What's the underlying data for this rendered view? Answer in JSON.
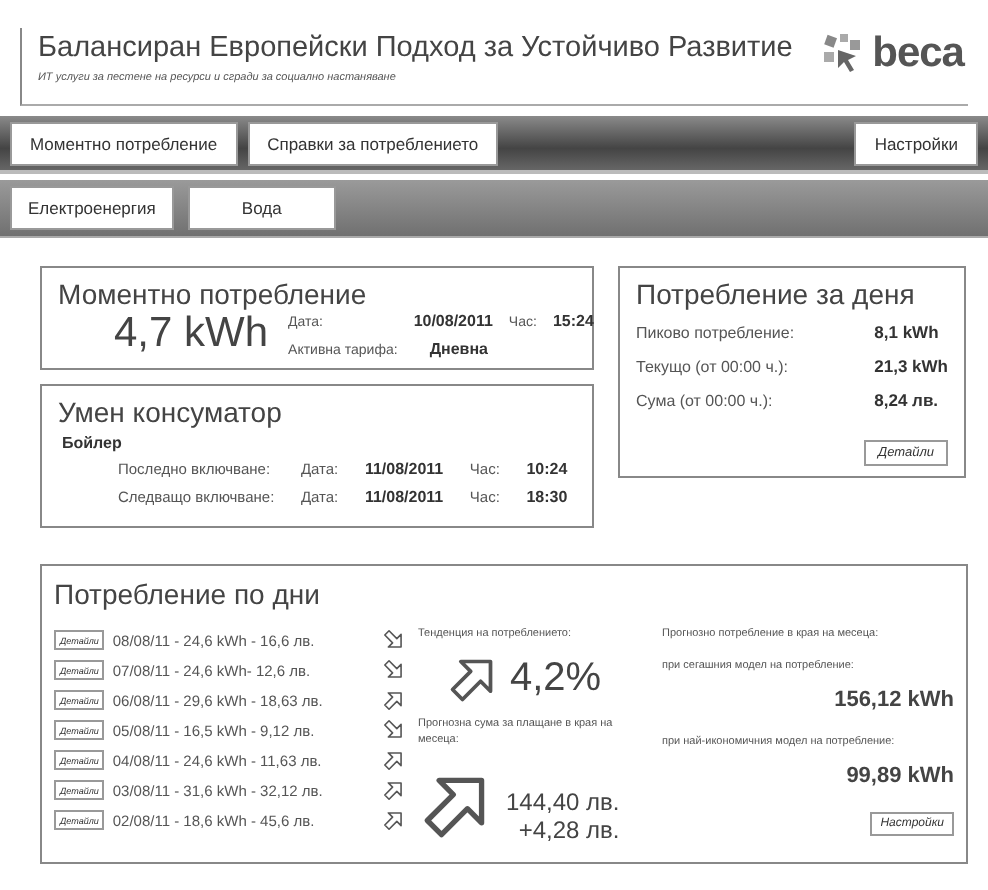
{
  "header": {
    "title": "Балансиран Европейски Подход за Устойчиво Развитие",
    "subtitle": "ИТ услуги за пестене на ресурси и сгради за социално настаняване",
    "logo": "beca"
  },
  "menu": {
    "items": [
      "Моментно потребление",
      "Справки за потреблението"
    ],
    "settings": "Настройки"
  },
  "submenu": [
    "Електроенергия",
    "Вода"
  ],
  "current": {
    "title": "Моментно потребление",
    "value": "4,7 kWh",
    "date_label": "Дата:",
    "date": "10/08/2011",
    "time_label": "Час:",
    "time": "15:24",
    "tariff_label": "Активна тарифа:",
    "tariff": "Дневна"
  },
  "today": {
    "title": "Потребление за деня",
    "rows": [
      {
        "label": "Пиково потребление:",
        "value": "8,1 kWh"
      },
      {
        "label": "Текущо (от 00:00 ч.):",
        "value": "21,3 kWh"
      },
      {
        "label": "Сума (от 00:00 ч.):",
        "value": "8,24 лв."
      }
    ],
    "button": "Детайли"
  },
  "smart": {
    "title": "Умен консуматор",
    "device": "Бойлер",
    "rows": [
      {
        "label": "Последно включване:",
        "date_label": "Дата:",
        "date": "11/08/2011",
        "time_label": "Час:",
        "time": "10:24"
      },
      {
        "label": "Следващо включване:",
        "date_label": "Дата:",
        "date": "11/08/2011",
        "time_label": "Час:",
        "time": "18:30"
      }
    ]
  },
  "daily": {
    "title": "Потребление по дни",
    "days": [
      {
        "button": "Детайли",
        "text": "08/08/11 - 24,6 kWh - 16,6 лв.",
        "kind": "down"
      },
      {
        "button": "Детайли",
        "text": "07/08/11 - 24,6 kWh- 12,6 лв.",
        "kind": "down"
      },
      {
        "button": "Детайли",
        "text": "06/08/11 - 29,6 kWh - 18,63 лв.",
        "kind": "up"
      },
      {
        "button": "Детайли",
        "text": "05/08/11 - 16,5 kWh - 9,12 лв.",
        "kind": "down"
      },
      {
        "button": "Детайли",
        "text": "04/08/11 - 24,6 kWh - 11,63 лв.",
        "kind": "up"
      },
      {
        "button": "Детайли",
        "text": "03/08/11 - 31,6 kWh - 32,12 лв.",
        "kind": "up"
      },
      {
        "button": "Детайли",
        "text": "02/08/11 - 18,6 kWh - 45,6 лв.",
        "kind": "up"
      }
    ],
    "trend_label": "Тенденция на потреблението:",
    "trend_value": "4,2%",
    "sum_label": "Прогнозна сума за плащане в края на месеца:",
    "sum_value": "144,40 лв.",
    "sum_delta": "+4,28 лв.",
    "forecast_title": "Прогнозно потребление в края на месеца:",
    "current_label": "при сегашния модел на потребление:",
    "current_value": "156,12 kWh",
    "best_label": "при най-икономичния модел на потребление:",
    "best_value": "99,89 kWh",
    "button": "Настройки"
  }
}
